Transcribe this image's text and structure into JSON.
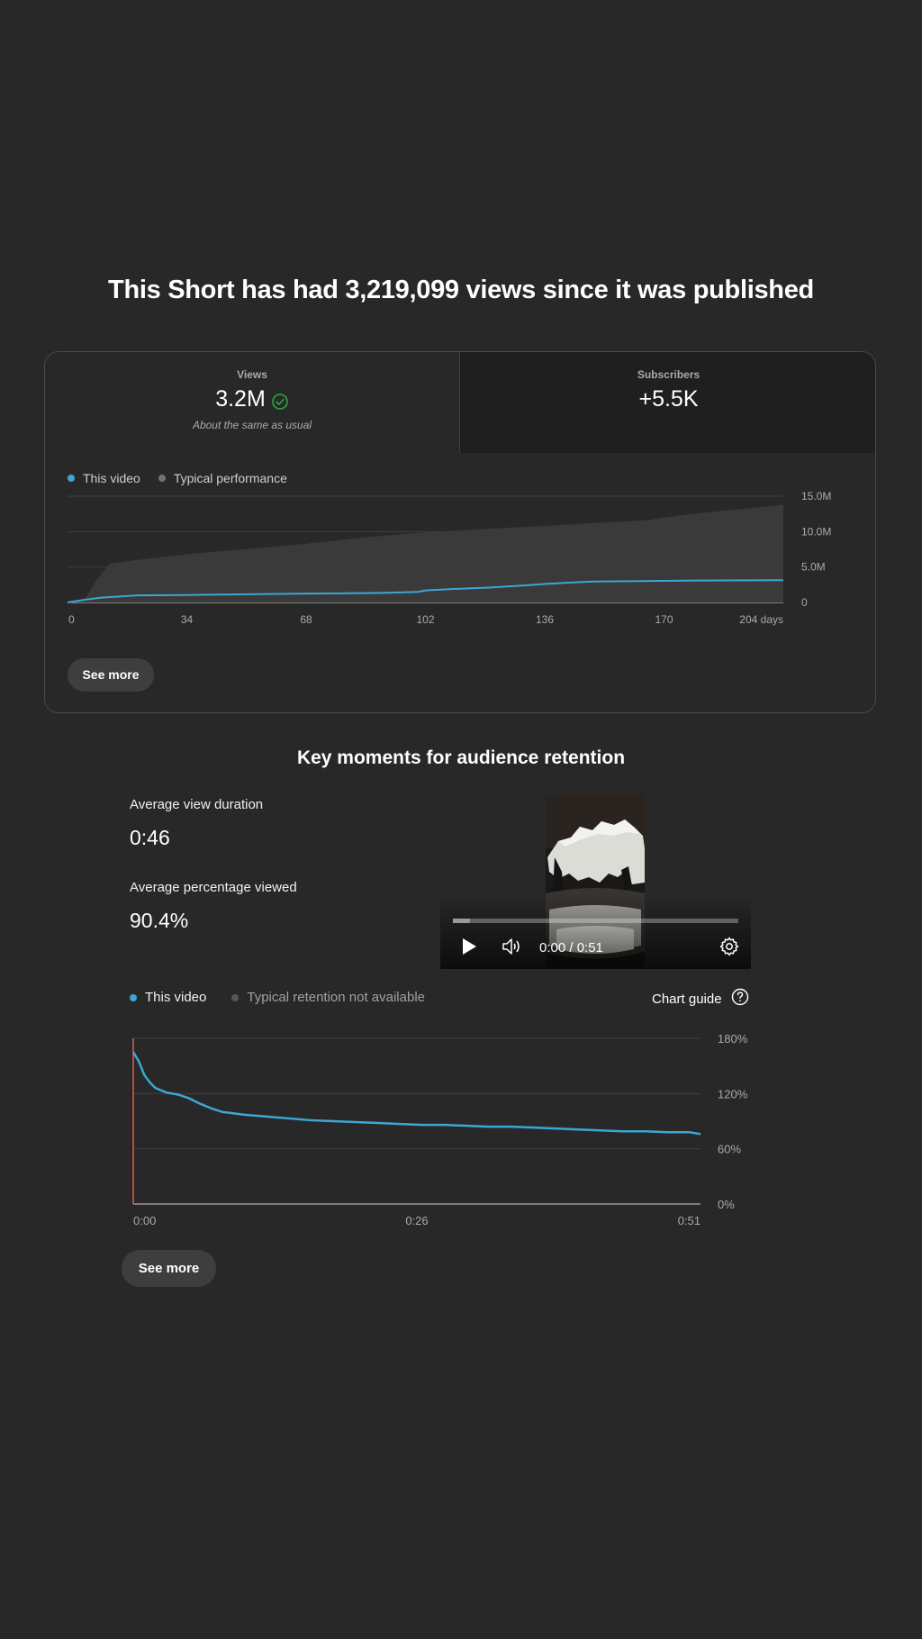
{
  "headline": "This Short has had 3,219,099 views since it was published",
  "summary_card": {
    "tabs": [
      {
        "label": "Views",
        "value": "3.2M",
        "note": "About the same as usual",
        "status_icon": "check-circle-icon",
        "status_color": "#2ba640"
      },
      {
        "label": "Subscribers",
        "value": "+5.5K"
      }
    ],
    "legend": [
      {
        "label": "This video",
        "color": "#3ea6d4"
      },
      {
        "label": "Typical performance",
        "color": "#717171"
      }
    ],
    "see_more_label": "See more"
  },
  "retention": {
    "title": "Key moments for audience retention",
    "avg_view_duration_label": "Average view duration",
    "avg_view_duration_value": "0:46",
    "avg_percentage_label": "Average percentage viewed",
    "avg_percentage_value": "90.4%",
    "player": {
      "time_text": "0:00 / 0:51",
      "progress_fraction": 0.06,
      "play_icon": "play-icon",
      "volume_icon": "volume-icon",
      "settings_icon": "settings-gear-icon"
    },
    "legend": [
      {
        "label": "This video",
        "color": "#3ea6d4"
      },
      {
        "label": "Typical retention not available",
        "color": "#555555"
      }
    ],
    "chart_guide_label": "Chart guide",
    "chart_guide_icon": "help-circle-icon",
    "see_more_label": "See more"
  },
  "chart_data": [
    {
      "type": "area",
      "title": "",
      "xlabel": "",
      "ylabel": "",
      "x_tick_labels": [
        "0",
        "34",
        "68",
        "102",
        "136",
        "170",
        "204 days"
      ],
      "y_tick_labels": [
        "15.0M",
        "10.0M",
        "5.0M",
        "0"
      ],
      "xlim": [
        0,
        204
      ],
      "ylim": [
        0,
        15000000
      ],
      "grid": true,
      "series": [
        {
          "name": "Typical performance",
          "color": "#3a3a3a",
          "x": [
            0,
            5,
            8,
            12,
            20,
            34,
            50,
            68,
            85,
            102,
            120,
            136,
            150,
            165,
            170,
            180,
            190,
            204
          ],
          "values": [
            0,
            500000,
            3000000,
            5500000,
            6000000,
            6800000,
            7500000,
            8300000,
            9200000,
            9900000,
            10400000,
            10800000,
            11200000,
            11600000,
            12000000,
            12600000,
            13100000,
            13800000
          ]
        },
        {
          "name": "This video",
          "color": "#3ea6d4",
          "x": [
            0,
            5,
            10,
            20,
            34,
            40,
            60,
            68,
            80,
            90,
            100,
            102,
            110,
            120,
            130,
            136,
            145,
            150,
            160,
            170,
            180,
            204
          ],
          "values": [
            0,
            400000,
            700000,
            1000000,
            1050000,
            1100000,
            1200000,
            1250000,
            1300000,
            1350000,
            1500000,
            1700000,
            1900000,
            2100000,
            2400000,
            2600000,
            2850000,
            2950000,
            3000000,
            3050000,
            3100000,
            3150000
          ]
        }
      ]
    },
    {
      "type": "line",
      "title": "",
      "xlabel": "",
      "ylabel": "",
      "x_tick_labels": [
        "0:00",
        "0:26",
        "0:51"
      ],
      "y_tick_labels": [
        "180%",
        "120%",
        "60%",
        "0%"
      ],
      "xlim": [
        0,
        51
      ],
      "ylim": [
        0,
        180
      ],
      "grid": true,
      "series": [
        {
          "name": "This video",
          "color": "#3ea6d4",
          "x": [
            0,
            0.5,
            1,
            1.5,
            2,
            3,
            4,
            5,
            6,
            7,
            8,
            10,
            12,
            14,
            16,
            18,
            20,
            22,
            24,
            26,
            28,
            30,
            32,
            34,
            36,
            38,
            40,
            42,
            44,
            46,
            48,
            49,
            50,
            51
          ],
          "values": [
            165,
            155,
            140,
            132,
            126,
            121,
            119,
            115,
            109,
            104,
            100,
            97,
            95,
            93,
            91,
            90,
            89,
            88,
            87,
            86,
            86,
            85,
            84,
            84,
            83,
            82,
            81,
            80,
            79,
            79,
            78,
            78,
            78,
            76
          ]
        }
      ],
      "marker": {
        "x": 0,
        "color": "#e05a4e"
      }
    }
  ]
}
